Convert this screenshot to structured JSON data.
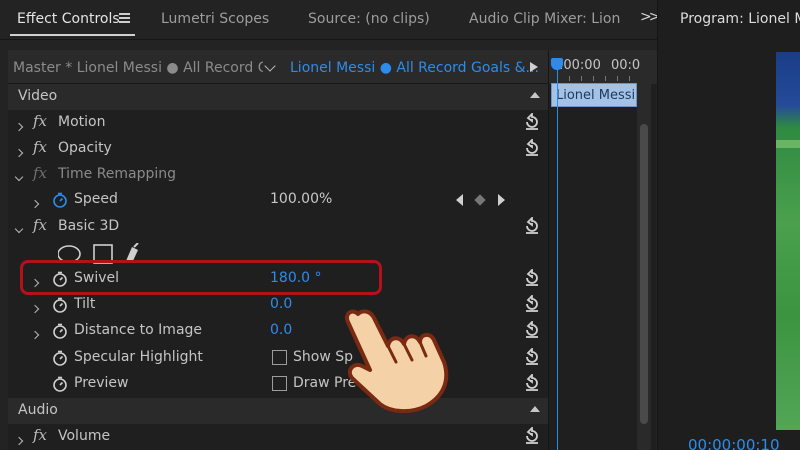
{
  "tabs": [
    {
      "label": "Effect Controls"
    },
    {
      "label": "Lumetri Scopes"
    },
    {
      "label": "Source: (no clips)"
    },
    {
      "label": "Audio Clip Mixer: Lion"
    }
  ],
  "program": {
    "title": "Program: Lionel M",
    "timecode": "00:00:00:10"
  },
  "source_header": {
    "master": "Master * Lionel Messi ● All Record G...",
    "sequence": "Lionel Messi ● All Record Goals &..."
  },
  "timeline": {
    "ruler_start": ":00:00",
    "ruler_end": "00:0",
    "clip_label": "Lionel Messi"
  },
  "sections": {
    "video": "Video",
    "audio": "Audio"
  },
  "effects": {
    "motion": "Motion",
    "opacity": "Opacity",
    "time_remapping": "Time Remapping",
    "speed_label": "Speed",
    "speed_value": "100.00%",
    "basic3d": "Basic 3D",
    "swivel_label": "Swivel",
    "swivel_value": "180.0 °",
    "tilt_label": "Tilt",
    "tilt_value": "0.0",
    "distance_label": "Distance to Image",
    "distance_value": "0.0",
    "specular_label": "Specular Highlight",
    "specular_checkbox": "Show Sp",
    "preview_label": "Preview",
    "preview_checkbox": "Draw Previ",
    "preview_checkbox_tail": "e",
    "volume": "Volume"
  },
  "colors": {
    "accent_blue": "#2d8ceb",
    "highlight_red": "#b3121b",
    "panel_bg": "#1f1f1f"
  },
  "icons": {
    "fx": "fx",
    "reset": "reset-icon",
    "stopwatch": "stopwatch-icon",
    "hand_pointer": "hand-pointer-icon"
  }
}
